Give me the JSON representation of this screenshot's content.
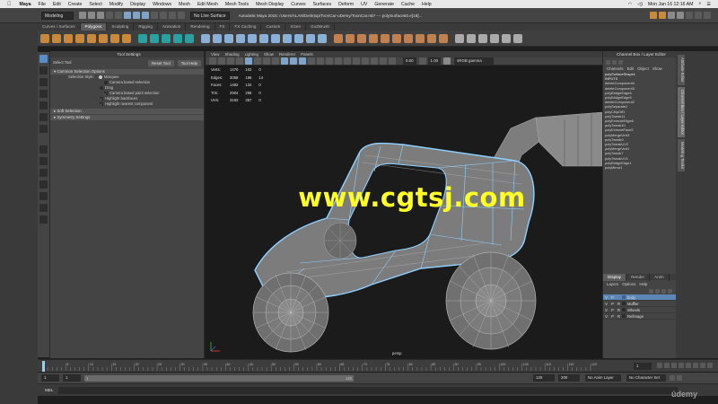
{
  "menubar": {
    "apple": "",
    "items": [
      "Maya",
      "File",
      "Edit",
      "Create",
      "Select",
      "Modify",
      "Display",
      "Windows",
      "Mesh",
      "Edit Mesh",
      "Mesh Tools",
      "Mesh Display",
      "Curves",
      "Surfaces",
      "Deform",
      "UV",
      "Generate",
      "Cache",
      "Help"
    ],
    "clock": "Mon Jan 16  12:16 AM"
  },
  "titlebar": "Autodesk Maya 2016: /Users/ALAN/Desktop/ToonCar-uDemy/ToonCar.mb*  ---  polySurface60.e[18]...",
  "status": {
    "menuset": "Modeling",
    "live_surface": "No Live Surface"
  },
  "shelf_tabs": [
    "Curves / Surfaces",
    "Polygons",
    "Sculpting",
    "Rigging",
    "Animation",
    "Rendering",
    "FX",
    "FX Caching",
    "Custom",
    "XGen",
    "GoZBrush"
  ],
  "shelf_active_tab": "Polygons",
  "tool_settings": {
    "panel_title": "Tool Settings",
    "tool_name": "Select Tool",
    "reset_label": "Reset Tool",
    "help_label": "Tool Help",
    "section_common": "Common Selection Options",
    "selection_style_label": "Selection Style:",
    "marquee_label": "Marquee",
    "camera_based_label": "Camera based selection",
    "drag_label": "Drag",
    "camera_paint_label": "Camera based paint selection",
    "highlight_backfaces": "Highlight backfaces",
    "highlight_nearest": "Highlight nearest component",
    "section_soft": "Soft Selection",
    "section_symmetry": "Symmetry Settings"
  },
  "viewport": {
    "menu": [
      "View",
      "Shading",
      "Lighting",
      "Show",
      "Renderer",
      "Panels"
    ],
    "exposure": "0.00",
    "gamma": "1.00",
    "colorspace": "sRGB gamma",
    "camera_label": "persp",
    "hud": [
      {
        "label": "Verts:",
        "a": "1470",
        "b": "102",
        "c": "0"
      },
      {
        "label": "Edges:",
        "a": "3058",
        "b": "196",
        "c": "14"
      },
      {
        "label": "Faces:",
        "a": "1482",
        "b": "134",
        "c": "0"
      },
      {
        "label": "Tris:",
        "a": "2904",
        "b": "266",
        "c": "0"
      },
      {
        "label": "UVs:",
        "a": "3163",
        "b": "357",
        "c": "0"
      }
    ],
    "watermark": "www.cgtsj.com"
  },
  "channel_box": {
    "title": "Channel Box / Layer Editor",
    "menu": [
      "Channels",
      "Edit",
      "Object",
      "Show"
    ],
    "object": "polySurfaceShape1",
    "inputs_label": "INPUTS",
    "history": [
      "deleteComponent4",
      "deleteComponent3",
      "polyBridgeEdge6",
      "polyBridgeEdge5",
      "deleteComponent2",
      "polySeparate2",
      "polyChipOff1",
      "polyTweak11",
      "polyExtrudeEdge6",
      "polyTweak10",
      "polyExtrudeFace5",
      "polyMergeVert3",
      "polyTweak9",
      "polyTweakUV2",
      "polyMergeVert1",
      "polyTweak7",
      "polyTweakUV1",
      "polyBridgeEdge1",
      "polyMirror1"
    ],
    "layer_tabs": [
      "Display",
      "Render",
      "Anim"
    ],
    "layer_menu": [
      "Layers",
      "Options",
      "Help"
    ],
    "layers": [
      {
        "v": "V",
        "p": "P",
        "r": "",
        "name": "body",
        "selected": true
      },
      {
        "v": "V",
        "p": "P",
        "r": "R",
        "name": "Muffler",
        "selected": false
      },
      {
        "v": "V",
        "p": "P",
        "r": "R",
        "name": "Wheels",
        "selected": false
      },
      {
        "v": "V",
        "p": "P",
        "r": "R",
        "name": "Refimage",
        "selected": false
      }
    ],
    "side_tabs": [
      "Attribute Editor",
      "Channel Box / Layer Editor",
      "Modeling Toolkit"
    ]
  },
  "timeline": {
    "current_frame": "1",
    "start": "1",
    "range_start": "1",
    "range_end": "120",
    "end": "120",
    "end2": "200",
    "anim_layer": "No Anim Layer",
    "char_set": "No Character Set",
    "ticks": [
      "5",
      "10",
      "15",
      "20",
      "25",
      "30",
      "35",
      "40",
      "45",
      "50",
      "55",
      "60",
      "65",
      "70",
      "75",
      "80",
      "85",
      "90",
      "95",
      "100",
      "105",
      "110",
      "115",
      "120"
    ]
  },
  "command_line": {
    "label": "MEL"
  },
  "udemy": "ûdemy",
  "colors": {
    "accent": "#5b86b5",
    "watermark": "#ffff28",
    "mesh": "#7a7a7a",
    "wire": "#8fd0ff"
  }
}
